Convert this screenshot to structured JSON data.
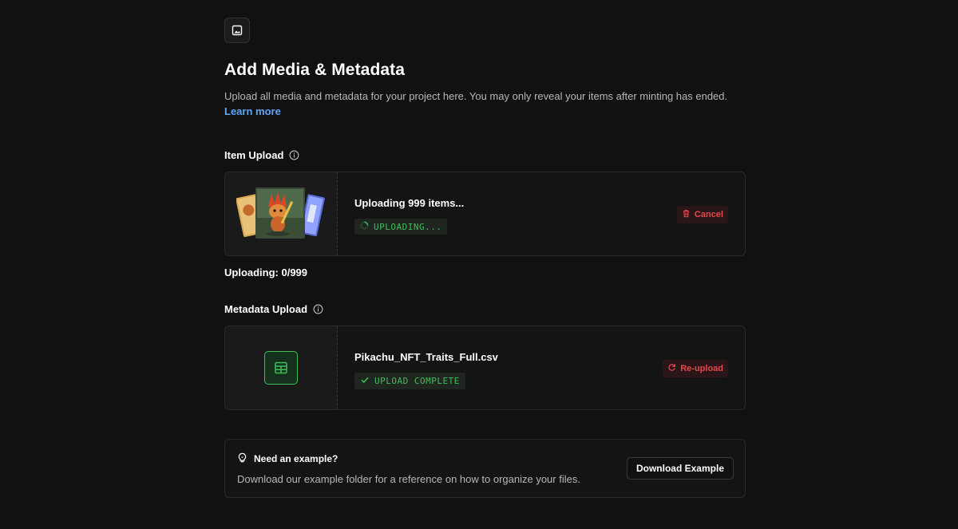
{
  "header": {
    "icon": "image-icon",
    "title": "Add Media & Metadata",
    "description": "Upload all media and metadata for your project here. You may only reveal your items after minting has ended.",
    "learn_more_label": "Learn more"
  },
  "item_upload": {
    "label": "Item Upload",
    "info_icon": "info-icon",
    "card": {
      "title": "Uploading 999 items...",
      "status": "UPLOADING...",
      "status_icon": "spinner-icon",
      "action_label": "Cancel",
      "action_icon": "trash-icon"
    },
    "progress_text": "Uploading: 0/999"
  },
  "metadata_upload": {
    "label": "Metadata Upload",
    "info_icon": "info-icon",
    "card": {
      "title": "Pikachu_NFT_Traits_Full.csv",
      "status": "UPLOAD COMPLETE",
      "status_icon": "check-icon",
      "thumb_icon": "table-icon",
      "action_label": "Re-upload",
      "action_icon": "refresh-icon"
    }
  },
  "example": {
    "icon": "lightbulb-icon",
    "title": "Need an example?",
    "description": "Download our example folder for a reference on how to organize your files.",
    "button_label": "Download Example"
  },
  "colors": {
    "background": "#111111",
    "accent_link": "#5aa8ff",
    "success": "#3fbf5a",
    "danger": "#e5484d"
  }
}
